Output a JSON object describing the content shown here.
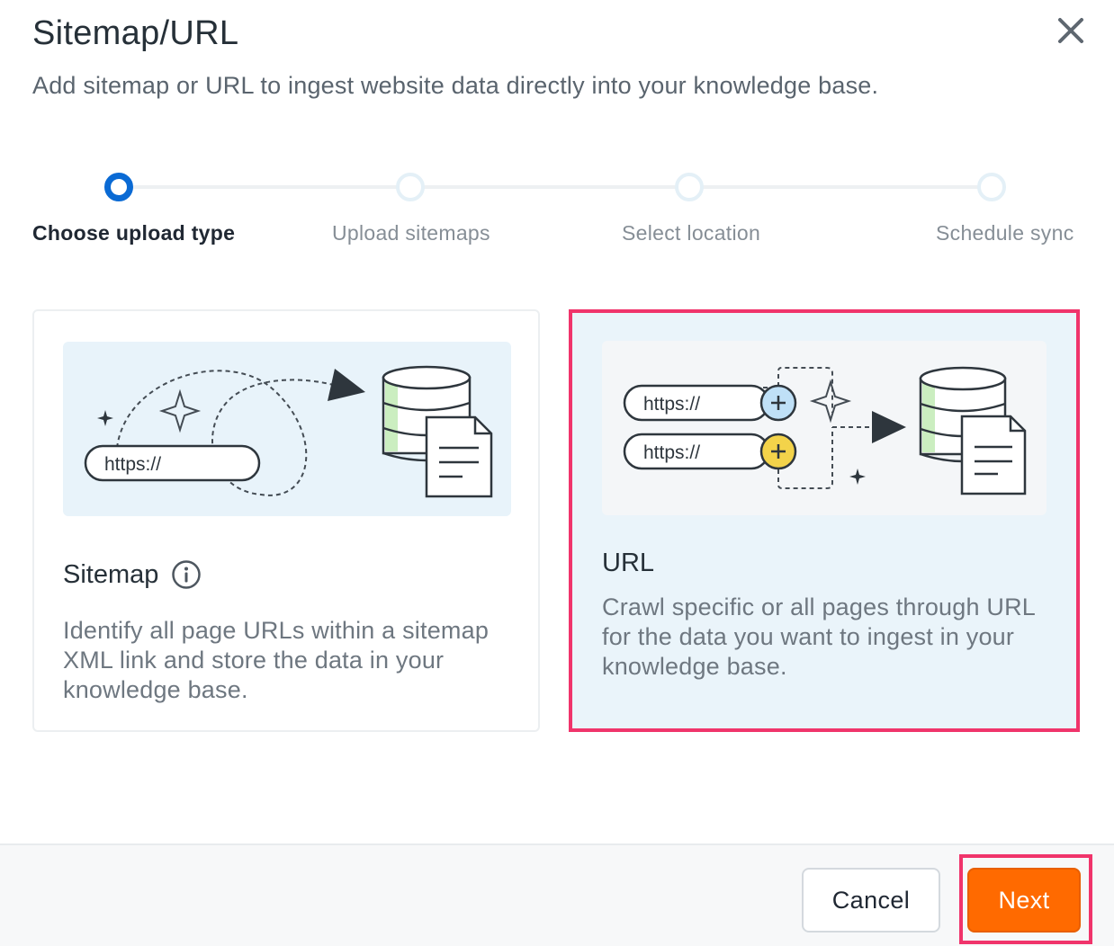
{
  "dialog": {
    "title": "Sitemap/URL",
    "subtitle": "Add sitemap or URL to ingest website data directly into your knowledge base.",
    "close_icon": "close-icon"
  },
  "stepper": {
    "steps": [
      {
        "label": "Choose upload type",
        "active": true
      },
      {
        "label": "Upload sitemaps",
        "active": false
      },
      {
        "label": "Select location",
        "active": false
      },
      {
        "label": "Schedule sync",
        "active": false
      }
    ]
  },
  "options": {
    "sitemap": {
      "title": "Sitemap",
      "description": "Identify all page URLs within a sitemap XML link and store the data in your knowledge base.",
      "illustration_text": "https://",
      "info_icon": "info-icon",
      "selected": false
    },
    "url": {
      "title": "URL",
      "description": "Crawl specific or all pages through URL for the data you want to ingest in your knowledge base.",
      "illustration_text_1": "https://",
      "illustration_text_2": "https://",
      "selected": true
    }
  },
  "footer": {
    "cancel_label": "Cancel",
    "next_label": "Next"
  },
  "colors": {
    "accent_blue": "#0a6ad4",
    "next_orange": "#ff6a00",
    "highlight_pink": "#f0346b",
    "selected_bg": "#eaf4fa"
  }
}
